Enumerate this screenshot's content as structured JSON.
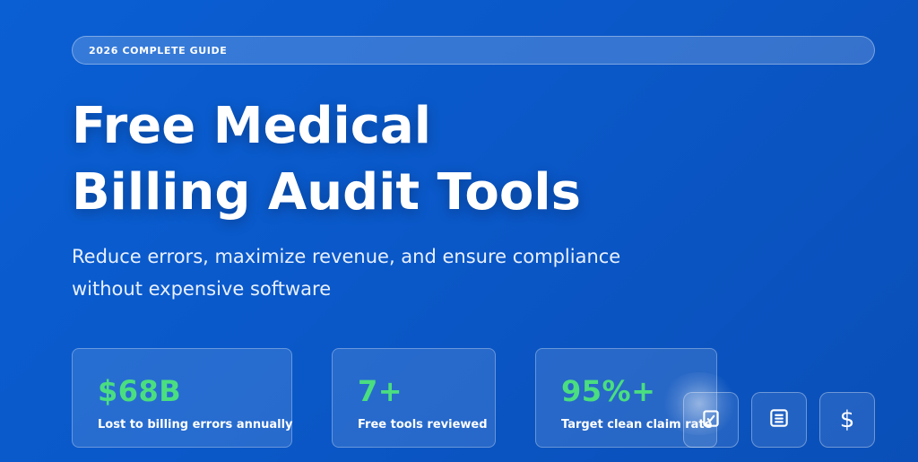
{
  "hero": {
    "badge": "2026 COMPLETE GUIDE",
    "title_line1": "Free Medical",
    "title_line2": "Billing Audit Tools",
    "subtitle_line1": "Reduce errors, maximize revenue, and ensure compliance",
    "subtitle_line2": "without expensive software"
  },
  "stats": [
    {
      "value": "$68B",
      "label": "Lost to billing errors annually"
    },
    {
      "value": "7+",
      "label": "Free tools reviewed"
    },
    {
      "value": "95%+",
      "label": "Target clean claim rate"
    }
  ],
  "icons": [
    {
      "name": "checklist-icon"
    },
    {
      "name": "document-icon"
    },
    {
      "name": "dollar-icon",
      "glyph": "$"
    }
  ],
  "colors": {
    "background": "#0a58c9",
    "accent": "#4ade80",
    "text": "#ffffff"
  }
}
